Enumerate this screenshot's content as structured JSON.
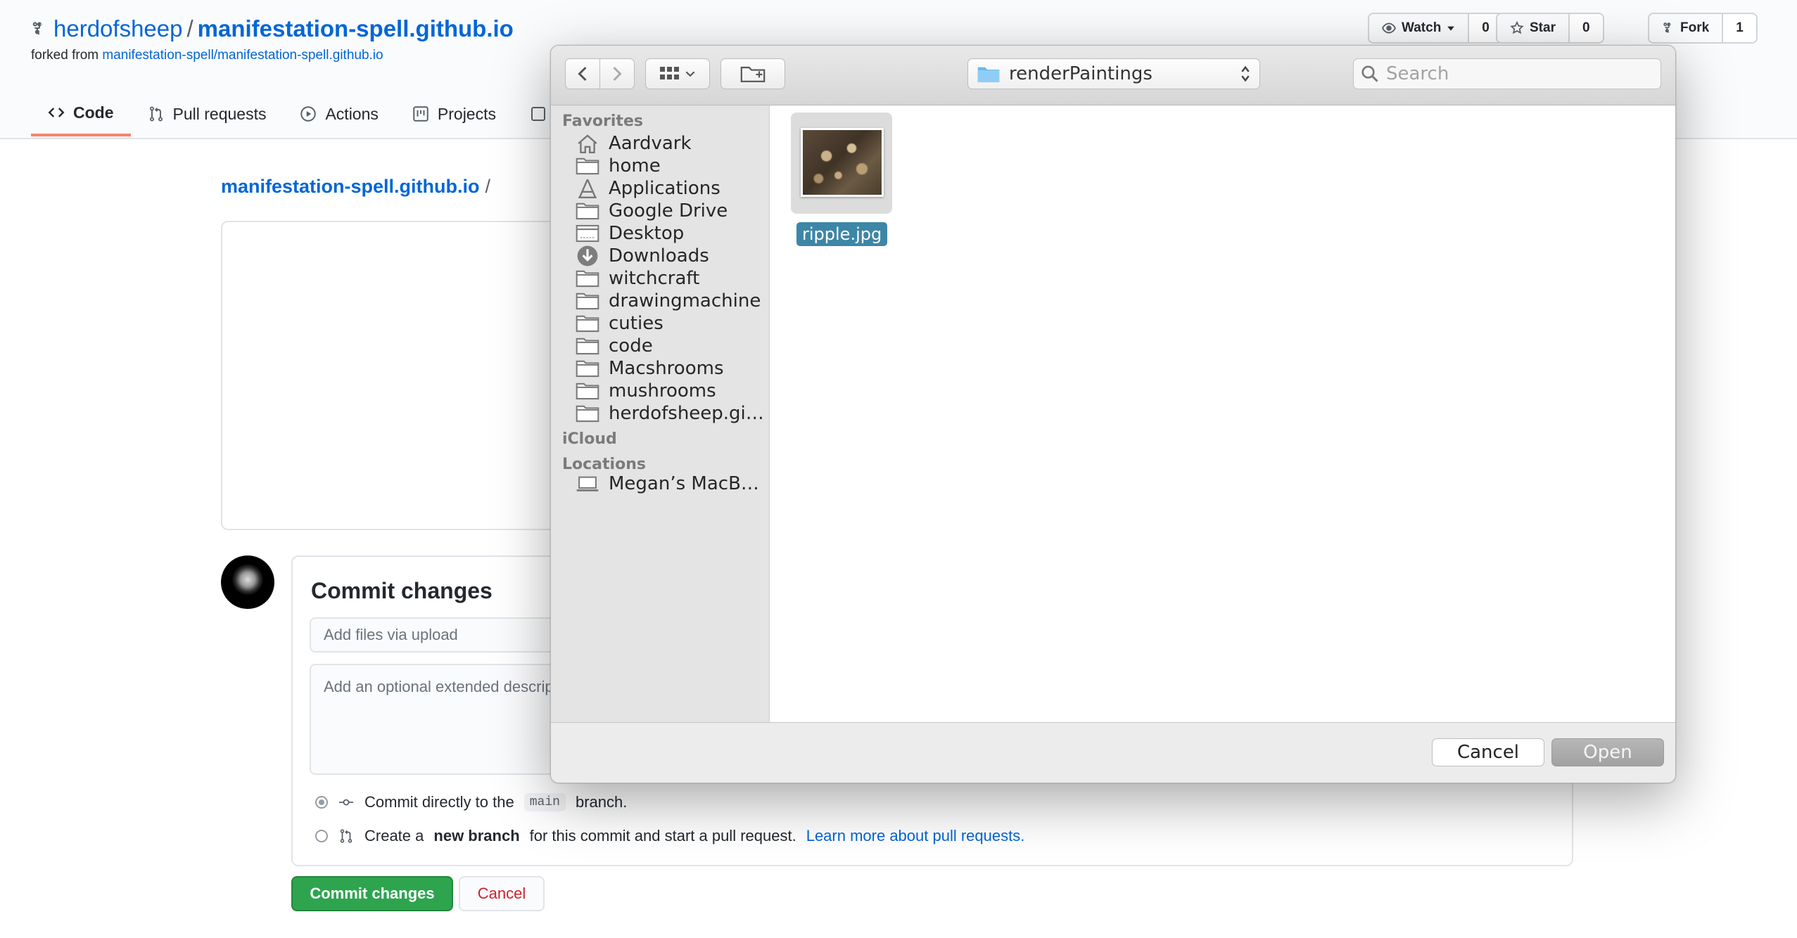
{
  "repo_header": {
    "owner": "herdofsheep",
    "separator": "/",
    "repo": "manifestation-spell.github.io",
    "forked_from_prefix": "forked from",
    "forked_from_link": "manifestation-spell/manifestation-spell.github.io",
    "watch": {
      "label": "Watch",
      "count": "0"
    },
    "star": {
      "label": "Star",
      "count": "0"
    },
    "fork": {
      "label": "Fork",
      "count": "1"
    }
  },
  "tabs": [
    {
      "label": "Code",
      "selected": true
    },
    {
      "label": "Pull requests"
    },
    {
      "label": "Actions"
    },
    {
      "label": "Projects"
    }
  ],
  "upload": {
    "breadcrumb_repo": "manifestation-spell.github.io",
    "breadcrumb_sep": "/",
    "commit_title": "Commit changes",
    "summary_placeholder": "Add files via upload",
    "description_placeholder": "Add an optional extended description…",
    "option_direct": {
      "prefix": "Commit directly to the",
      "branch": "main",
      "suffix": "branch."
    },
    "option_new": {
      "prefix": "Create a",
      "bold": "new branch",
      "suffix": "for this commit and start a pull request.",
      "link": "Learn more about pull requests."
    },
    "commit_button": "Commit changes",
    "cancel_button": "Cancel"
  },
  "dialog": {
    "location": "renderPaintings",
    "search_placeholder": "Search",
    "sections": {
      "favorites": "Favorites",
      "icloud": "iCloud",
      "locations": "Locations"
    },
    "favorites": [
      {
        "label": "Aardvark",
        "icon": "home-icon"
      },
      {
        "label": "home",
        "icon": "folder-icon"
      },
      {
        "label": "Applications",
        "icon": "applications-icon"
      },
      {
        "label": "Google Drive",
        "icon": "folder-icon"
      },
      {
        "label": "Desktop",
        "icon": "desktop-icon"
      },
      {
        "label": "Downloads",
        "icon": "downloads-icon"
      },
      {
        "label": "witchcraft",
        "icon": "folder-icon"
      },
      {
        "label": "drawingmachine",
        "icon": "folder-icon"
      },
      {
        "label": "cuties",
        "icon": "folder-icon"
      },
      {
        "label": "code",
        "icon": "folder-icon"
      },
      {
        "label": "Macshrooms",
        "icon": "folder-icon"
      },
      {
        "label": "mushrooms",
        "icon": "folder-icon"
      },
      {
        "label": "herdofsheep.gi…",
        "icon": "folder-icon"
      }
    ],
    "locations": [
      {
        "label": "Megan’s MacB…",
        "icon": "laptop-icon"
      }
    ],
    "files": [
      {
        "name": "ripple.jpg",
        "selected": true
      }
    ],
    "cancel": "Cancel",
    "open": "Open"
  },
  "colors": {
    "link": "#0366d6",
    "primary_green": "#2ea44f",
    "selection": "#3d86a8",
    "tab_accent": "#f9826c"
  }
}
